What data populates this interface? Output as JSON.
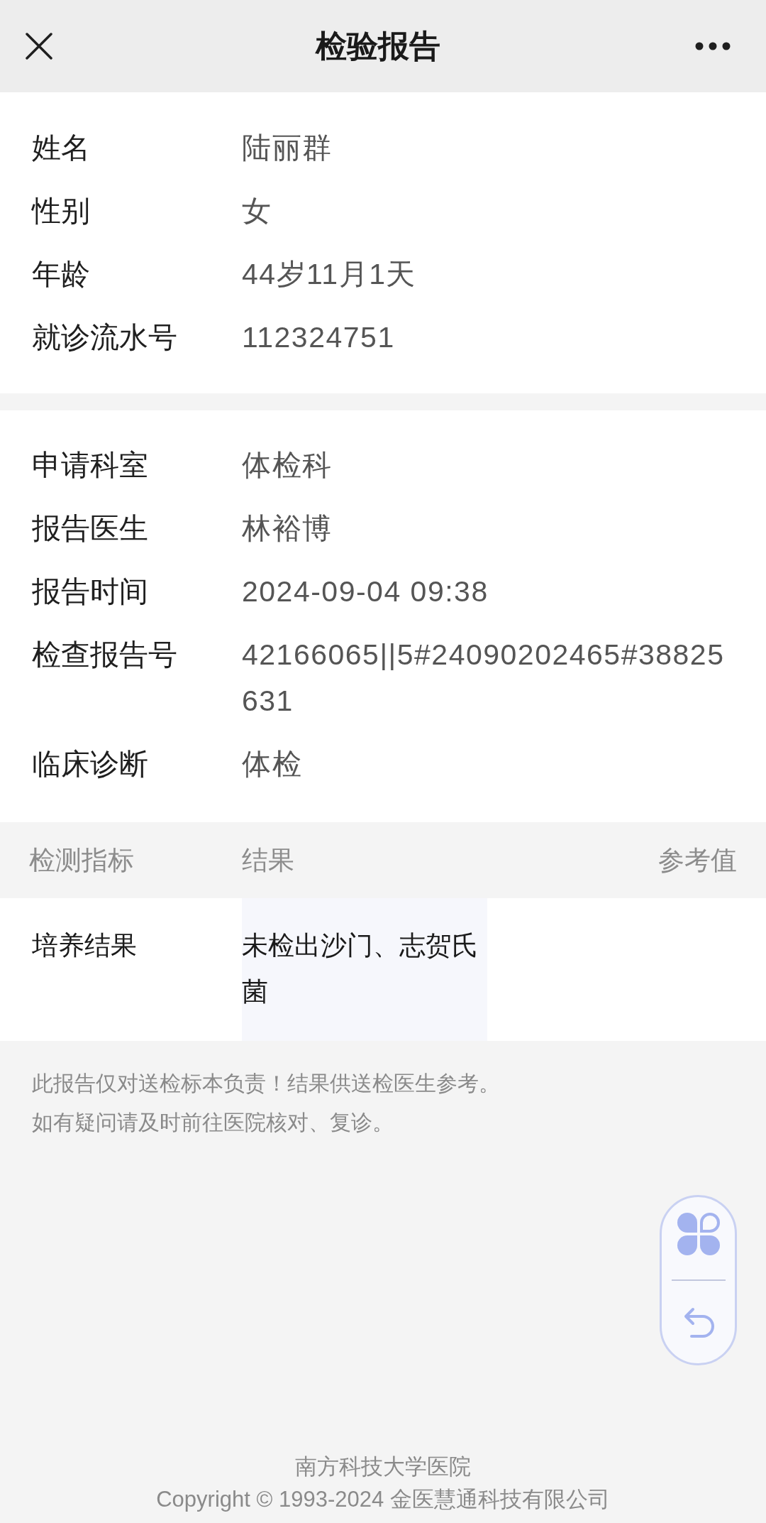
{
  "header": {
    "title": "检验报告"
  },
  "patient_info": [
    {
      "label": "姓名",
      "value": "陆丽群"
    },
    {
      "label": "性别",
      "value": "女"
    },
    {
      "label": "年龄",
      "value": "44岁11月1天"
    },
    {
      "label": "就诊流水号",
      "value": "112324751"
    }
  ],
  "report_info": [
    {
      "label": "申请科室",
      "value": "体检科"
    },
    {
      "label": "报告医生",
      "value": "林裕博"
    },
    {
      "label": "报告时间",
      "value": "2024-09-04 09:38"
    },
    {
      "label": "检查报告号",
      "value": "42166065||5#24090202465#38825631"
    },
    {
      "label": "临床诊断",
      "value": "体检"
    }
  ],
  "results_table": {
    "columns": [
      "检测指标",
      "结果",
      "参考值"
    ],
    "rows": [
      {
        "item": "培养结果",
        "result": "未检出沙门、志贺氏菌"
      }
    ]
  },
  "notice": [
    "此报告仅对送检标本负责！结果供送检医生参考。",
    "如有疑问请及时前往医院核对、复诊。"
  ],
  "footer": {
    "hospital": "南方科技大学医院",
    "copyright": "Copyright © 1993-2024 金医慧通科技有限公司"
  }
}
